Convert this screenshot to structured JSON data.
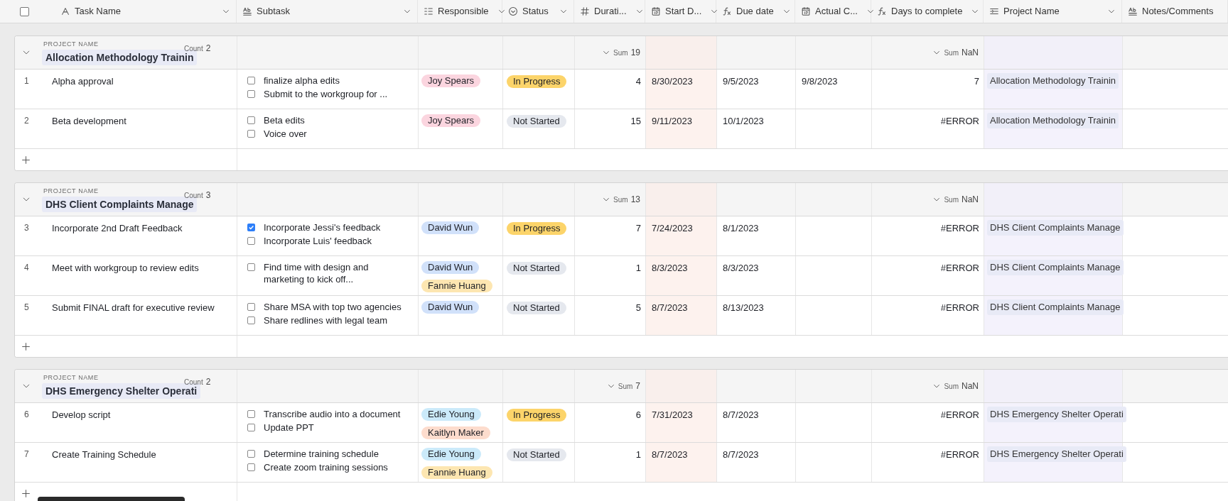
{
  "select_all": {
    "checked": false
  },
  "columns": [
    {
      "label": "Task Name",
      "kind": "text",
      "dropdown": true
    },
    {
      "label": "Subtask",
      "kind": "long_text",
      "dropdown": true
    },
    {
      "label": "Responsible",
      "kind": "person",
      "dropdown": true
    },
    {
      "label": "Status",
      "kind": "status",
      "dropdown": true
    },
    {
      "label": "Durati...",
      "kind": "number",
      "dropdown": true
    },
    {
      "label": "Start D...",
      "kind": "date",
      "dropdown": true
    },
    {
      "label": "Due date",
      "kind": "formula",
      "dropdown": true
    },
    {
      "label": "Actual C...",
      "kind": "date",
      "dropdown": true
    },
    {
      "label": "Days to complete",
      "kind": "formula",
      "dropdown": true
    },
    {
      "label": "Project Name",
      "kind": "lookup",
      "dropdown": true
    },
    {
      "label": "Notes/Comments",
      "kind": "long_text",
      "dropdown": false
    }
  ],
  "groups": [
    {
      "field_label": "PROJECT NAME",
      "name": "Allocation Methodology Trainin",
      "count_label": "Count",
      "count": "2",
      "duration_sum": {
        "label": "Sum",
        "value": "19"
      },
      "days_sum": {
        "label": "Sum",
        "value": "NaN"
      },
      "rows": [
        {
          "number": "1",
          "task": "Alpha approval",
          "subtasks": [
            {
              "text": "finalize alpha edits",
              "checked": false
            },
            {
              "text": "Submit to the workgroup for ...",
              "checked": false
            }
          ],
          "responsible": [
            {
              "name": "Joy Spears",
              "color": "#fbd5df"
            }
          ],
          "status": {
            "text": "In Progress",
            "color": "#fcd46a"
          },
          "duration": "4",
          "start": "8/30/2023",
          "due": "9/5/2023",
          "actual": "9/8/2023",
          "days": "7",
          "project": "Allocation Methodology Trainin"
        },
        {
          "number": "2",
          "task": "Beta development",
          "subtasks": [
            {
              "text": "Beta edits",
              "checked": false
            },
            {
              "text": "Voice over",
              "checked": false
            }
          ],
          "responsible": [
            {
              "name": "Joy Spears",
              "color": "#fbd5df"
            }
          ],
          "status": {
            "text": "Not Started",
            "color": "#e5e8ee"
          },
          "duration": "15",
          "start": "9/11/2023",
          "due": "10/1/2023",
          "days": "#ERROR",
          "project": "Allocation Methodology Trainin"
        }
      ]
    },
    {
      "field_label": "PROJECT NAME",
      "name": "DHS Client Complaints Manage",
      "count_label": "Count",
      "count": "3",
      "duration_sum": {
        "label": "Sum",
        "value": "13"
      },
      "days_sum": {
        "label": "Sum",
        "value": "NaN"
      },
      "rows": [
        {
          "number": "3",
          "task": "Incorporate 2nd Draft Feedback",
          "subtasks": [
            {
              "text": "Incorporate Jessi's feedback",
              "checked": true
            },
            {
              "text": "Incorporate Luis' feedback",
              "checked": false
            }
          ],
          "responsible": [
            {
              "name": "David Wun",
              "color": "#d1e1fa"
            }
          ],
          "status": {
            "text": "In Progress",
            "color": "#fcd46a"
          },
          "duration": "7",
          "start": "7/24/2023",
          "due": "8/1/2023",
          "days": "#ERROR",
          "project": "DHS Client Complaints Manage"
        },
        {
          "number": "4",
          "task": "Meet with workgroup to review edits",
          "subtasks": [
            {
              "text": "Find time with design and marketing to kick off...",
              "checked": false
            }
          ],
          "responsible": [
            {
              "name": "David Wun",
              "color": "#d1e1fa"
            },
            {
              "name": "Fannie Huang",
              "color": "#fde6b1"
            }
          ],
          "status": {
            "text": "Not Started",
            "color": "#e5e8ee"
          },
          "duration": "1",
          "start": "8/3/2023",
          "due": "8/3/2023",
          "days": "#ERROR",
          "project": "DHS Client Complaints Manage"
        },
        {
          "number": "5",
          "task": "Submit FINAL draft for executive review",
          "subtasks": [
            {
              "text": "Share MSA with top two agencies",
              "checked": false
            },
            {
              "text": "Share redlines with legal team",
              "checked": false
            }
          ],
          "responsible": [
            {
              "name": "David Wun",
              "color": "#d1e1fa"
            }
          ],
          "status": {
            "text": "Not Started",
            "color": "#e5e8ee"
          },
          "duration": "5",
          "start": "8/7/2023",
          "due": "8/13/2023",
          "days": "#ERROR",
          "project": "DHS Client Complaints Manage"
        }
      ]
    },
    {
      "field_label": "PROJECT NAME",
      "name": "DHS Emergency Shelter Operati",
      "count_label": "Count",
      "count": "2",
      "duration_sum": {
        "label": "Sum",
        "value": "7"
      },
      "days_sum": {
        "label": "Sum",
        "value": "NaN"
      },
      "rows": [
        {
          "number": "6",
          "task": "Develop script",
          "subtasks": [
            {
              "text": "Transcribe audio into a document",
              "checked": false
            },
            {
              "text": "Update PPT",
              "checked": false
            }
          ],
          "responsible": [
            {
              "name": "Edie Young",
              "color": "#cbeafa"
            },
            {
              "name": "Kaitlyn Maker",
              "color": "#fddccd"
            }
          ],
          "status": {
            "text": "In Progress",
            "color": "#fcd46a"
          },
          "duration": "6",
          "start": "7/31/2023",
          "due": "8/7/2023",
          "days": "#ERROR",
          "project": "DHS Emergency Shelter Operati"
        },
        {
          "number": "7",
          "task": "Create Training Schedule",
          "subtasks": [
            {
              "text": "Determine training schedule",
              "checked": false
            },
            {
              "text": "Create zoom training sessions",
              "checked": false
            }
          ],
          "responsible": [
            {
              "name": "Edie Young",
              "color": "#cbeafa"
            },
            {
              "name": "Fannie Huang",
              "color": "#fde6b1"
            }
          ],
          "status": {
            "text": "Not Started",
            "color": "#e5e8ee"
          },
          "duration": "1",
          "start": "8/7/2023",
          "due": "8/7/2023",
          "days": "#ERROR",
          "project": "DHS Emergency Shelter Operati"
        }
      ]
    }
  ],
  "tooltip": {
    "kind": "tooltip"
  }
}
